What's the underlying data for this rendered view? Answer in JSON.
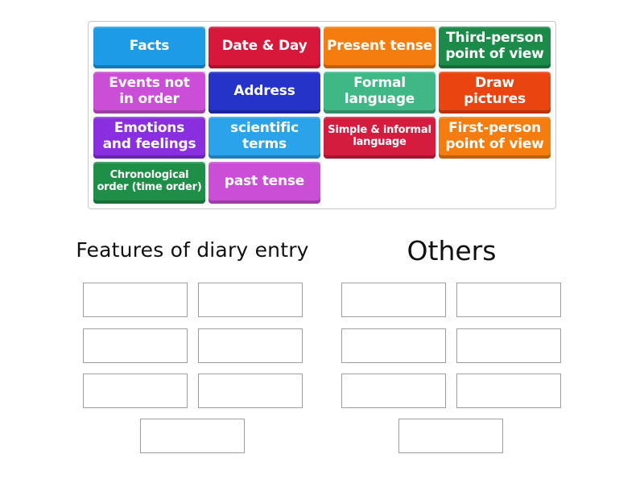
{
  "activity": {
    "tiles": [
      {
        "label": "Facts",
        "color": "#1e9be6",
        "size": "big"
      },
      {
        "label": "Date & Day",
        "color": "#d8183a",
        "size": "big"
      },
      {
        "label": "Present tense",
        "color": "#f57d10",
        "size": "big"
      },
      {
        "label": "Third-person\npoint of view",
        "color": "#1c8a48",
        "size": "big"
      },
      {
        "label": "Events not\nin order",
        "color": "#cb4fd6",
        "size": "big"
      },
      {
        "label": "Address",
        "color": "#2533c8",
        "size": "big"
      },
      {
        "label": "Formal\nlanguage",
        "color": "#3fb885",
        "size": "big"
      },
      {
        "label": "Draw\npictures",
        "color": "#ea4410",
        "size": "big"
      },
      {
        "label": "Emotions\nand feelings",
        "color": "#8a2fe0",
        "size": "big"
      },
      {
        "label": "scientific\nterms",
        "color": "#2aa3ea",
        "size": "big"
      },
      {
        "label": "Simple & informal\nlanguage",
        "color": "#d41c3e",
        "size": "small"
      },
      {
        "label": "First-person\npoint of view",
        "color": "#f57d10",
        "size": "big"
      },
      {
        "label": "Chronological\norder (time order)",
        "color": "#1f8f48",
        "size": "small"
      },
      {
        "label": "past tense",
        "color": "#cb4fd6",
        "size": "big"
      }
    ]
  },
  "groups": [
    {
      "title": "Features of diary entry",
      "slots": 7
    },
    {
      "title": "Others",
      "slots": 7
    }
  ]
}
